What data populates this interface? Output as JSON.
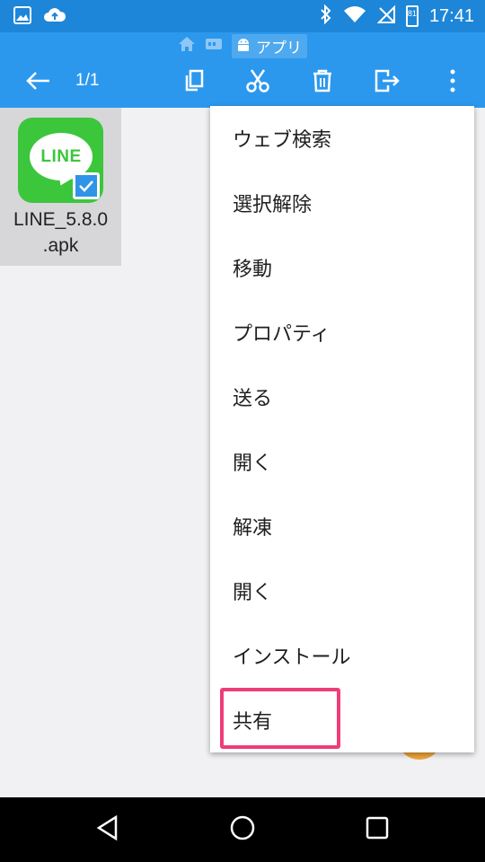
{
  "status_bar": {
    "time": "17:41",
    "left_icons": [
      "image-icon",
      "cloud-upload-icon"
    ],
    "right_icons": [
      "bluetooth-icon",
      "wifi-icon",
      "no-signal-icon",
      "battery-icon"
    ],
    "battery_level": "81"
  },
  "breadcrumb": {
    "current_folder": "アプリ",
    "icons": [
      "home-icon",
      "storage-icon",
      "android-icon"
    ]
  },
  "toolbar": {
    "selection_count": "1/1",
    "icons": [
      "back-arrow-icon",
      "copy-icon",
      "cut-icon",
      "delete-icon",
      "move-icon",
      "more-vert-icon"
    ]
  },
  "file": {
    "name": "LINE_5.8.0.apk",
    "name_line1": "LINE_5.8.0",
    "name_line2": ".apk",
    "icon_text": "LINE",
    "selected": true
  },
  "menu": {
    "items": [
      {
        "label": "ウェブ検索"
      },
      {
        "label": "選択解除"
      },
      {
        "label": "移動"
      },
      {
        "label": "プロパティ"
      },
      {
        "label": "送る"
      },
      {
        "label": "開く"
      },
      {
        "label": "解凍"
      },
      {
        "label": "開く"
      },
      {
        "label": "インストール"
      },
      {
        "label": "共有"
      }
    ],
    "highlighted_item": "共有"
  },
  "colors": {
    "status_bar": "#1d86d8",
    "app_bar": "#2b98ee",
    "highlight": "#ee3d7a",
    "line_green": "#3cc63c"
  },
  "nav_bar": {
    "icons": [
      "back-triangle-icon",
      "home-circle-icon",
      "recents-square-icon"
    ]
  }
}
